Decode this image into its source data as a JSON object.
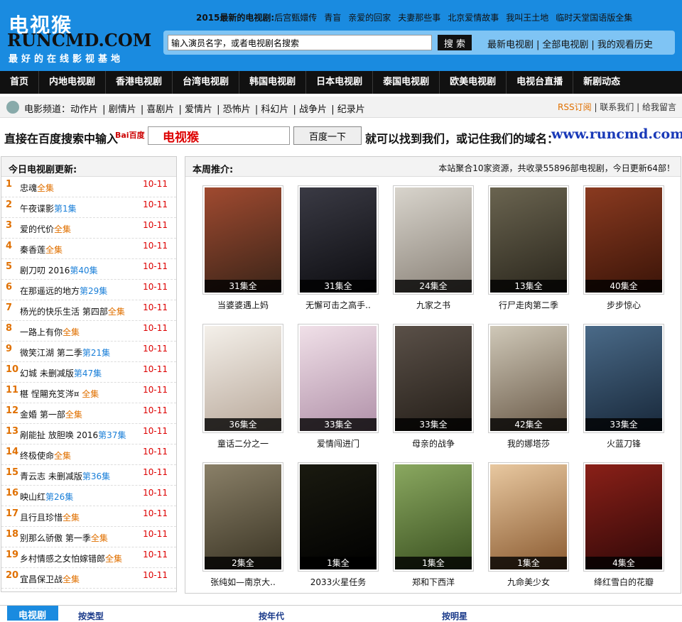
{
  "logo": {
    "cn": "电视猴",
    "en": "RUNCMD.COM",
    "tag": "最好的在线影视基地"
  },
  "hot": {
    "label": "2015最新的电视剧:",
    "items": [
      "后宫甄嬛传",
      "青盲",
      "亲爱的回家",
      "夫妻那些事",
      "北京爱情故事",
      "我叫王土地",
      "临时天堂国语版全集"
    ]
  },
  "search": {
    "placeholder": "输入演员名字，或者电视剧名搜索",
    "button": "搜 索"
  },
  "head_links": [
    "最新电视剧",
    "全部电视剧",
    "我的观看历史"
  ],
  "nav": [
    "首页",
    "内地电视剧",
    "香港电视剧",
    "台湾电视剧",
    "韩国电视剧",
    "日本电视剧",
    "泰国电视剧",
    "欧美电视剧",
    "电视台直播",
    "新剧动态"
  ],
  "film_channel": {
    "label": "电影频道：",
    "items": [
      "动作片",
      "剧情片",
      "喜剧片",
      "爱情片",
      "恐怖片",
      "科幻片",
      "战争片",
      "纪录片"
    ]
  },
  "right_links": {
    "rss": "RSS订阅",
    "contact": "联系我们",
    "message": "给我留言"
  },
  "baidu": {
    "pre": "直接在百度搜索中输入",
    "logo": "Bai百度",
    "input": "电视猴",
    "button": "百度一下",
    "post": "就可以找到我们，或记住我们的域名：",
    "domain": "www.runcmd.com"
  },
  "updates": {
    "title": "今日电视剧更新:",
    "items": [
      {
        "n": "1",
        "t": "忠魂",
        "e": "全集",
        "blue": false,
        "d": "10-11"
      },
      {
        "n": "2",
        "t": "午夜谍影",
        "e": "第1集",
        "blue": true,
        "d": "10-11"
      },
      {
        "n": "3",
        "t": "爱的代价",
        "e": "全集",
        "blue": false,
        "d": "10-11"
      },
      {
        "n": "4",
        "t": "秦香莲",
        "e": "全集",
        "blue": false,
        "d": "10-11"
      },
      {
        "n": "5",
        "t": "剧刀叨 2016",
        "e": "第40集",
        "blue": true,
        "d": "10-11"
      },
      {
        "n": "6",
        "t": "在那遥远的地方",
        "e": "第29集",
        "blue": true,
        "d": "10-11"
      },
      {
        "n": "7",
        "t": "杨光的快乐生活 第四部",
        "e": "全集",
        "blue": false,
        "d": "10-11"
      },
      {
        "n": "8",
        "t": "一路上有你",
        "e": "全集",
        "blue": false,
        "d": "10-11"
      },
      {
        "n": "9",
        "t": "微笑江湖 第二季",
        "e": "第21集",
        "blue": true,
        "d": "10-11"
      },
      {
        "n": "10",
        "t": "幻城 未删减版",
        "e": "第47集",
        "blue": true,
        "d": "10-11"
      },
      {
        "n": "11",
        "t": "椹 悜闀充笅涔¤ ",
        "e": "全集",
        "blue": false,
        "d": "10-11"
      },
      {
        "n": "12",
        "t": "金婚 第一部",
        "e": "全集",
        "blue": false,
        "d": "10-11"
      },
      {
        "n": "13",
        "t": "剐能扯 放胆唤 2016",
        "e": "第37集",
        "blue": true,
        "d": "10-11"
      },
      {
        "n": "14",
        "t": "终极使命",
        "e": "全集",
        "blue": false,
        "d": "10-11"
      },
      {
        "n": "15",
        "t": "青云志 未删减版",
        "e": "第36集",
        "blue": true,
        "d": "10-11"
      },
      {
        "n": "16",
        "t": "映山红",
        "e": "第26集",
        "blue": true,
        "d": "10-11"
      },
      {
        "n": "17",
        "t": "且行且珍惜",
        "e": "全集",
        "blue": false,
        "d": "10-11"
      },
      {
        "n": "18",
        "t": "别那么骄傲 第一季",
        "e": "全集",
        "blue": false,
        "d": "10-11"
      },
      {
        "n": "19",
        "t": "乡村情感之女怕嫁错郎",
        "e": "全集",
        "blue": false,
        "d": "10-11"
      },
      {
        "n": "20",
        "t": "宜昌保卫战",
        "e": "全集",
        "blue": false,
        "d": "10-11"
      }
    ]
  },
  "weekly": {
    "title": "本周推介:",
    "stat": "本站聚合10家资源，共收录55896部电视剧，今日更新64部！",
    "movies": [
      {
        "title": "当婆婆遇上妈",
        "ep": "31集全",
        "c1": "#a04a30",
        "c2": "#3a2418"
      },
      {
        "title": "无懈可击之高手..",
        "ep": "31集全",
        "c1": "#3a3a44",
        "c2": "#0c0c10"
      },
      {
        "title": "九家之书",
        "ep": "24集全",
        "c1": "#d8d4cc",
        "c2": "#8a8278"
      },
      {
        "title": "行尸走肉第二季",
        "ep": "13集全",
        "c1": "#6a6450",
        "c2": "#2a261c"
      },
      {
        "title": "步步惊心",
        "ep": "40集全",
        "c1": "#8a3a20",
        "c2": "#3a1408"
      },
      {
        "title": "童话二分之一",
        "ep": "36集全",
        "c1": "#f4f0ea",
        "c2": "#b8a89a"
      },
      {
        "title": "爱情闯进门",
        "ep": "33集全",
        "c1": "#f0e0e8",
        "c2": "#b090a8"
      },
      {
        "title": "母亲的战争",
        "ep": "33集全",
        "c1": "#5a5048",
        "c2": "#241e18"
      },
      {
        "title": "我的娜塔莎",
        "ep": "42集全",
        "c1": "#cfc8b8",
        "c2": "#6a5a48"
      },
      {
        "title": "火蓝刀锋",
        "ep": "33集全",
        "c1": "#4a6a88",
        "c2": "#18283a"
      },
      {
        "title": "张纯如—南京大..",
        "ep": "2集全",
        "c1": "#8a8068",
        "c2": "#3a3424"
      },
      {
        "title": "2033火星任务",
        "ep": "1集全",
        "c1": "#1a1a10",
        "c2": "#000000"
      },
      {
        "title": "郑和下西洋",
        "ep": "1集全",
        "c1": "#8aa860",
        "c2": "#3a5020"
      },
      {
        "title": "九命美少女",
        "ep": "1集全",
        "c1": "#e8c8a0",
        "c2": "#8a5a30"
      },
      {
        "title": "绛红雪白的花瓣",
        "ep": "4集全",
        "c1": "#8a2018",
        "c2": "#300808"
      }
    ]
  },
  "bottom_tabs": {
    "tv": "电视剧",
    "by_type": "按类型",
    "by_year": "按年代",
    "by_star": "按明星"
  }
}
